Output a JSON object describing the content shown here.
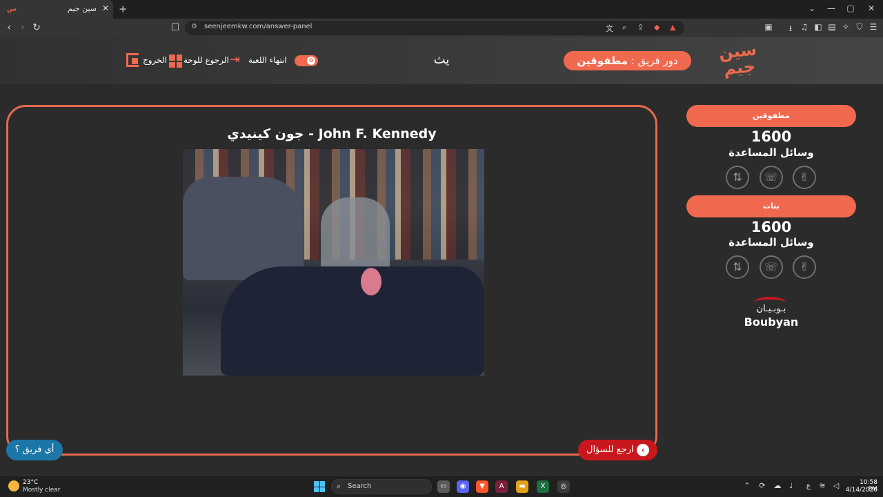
{
  "browser": {
    "tab_title": "سين جيم",
    "tab_close": "✕",
    "new_tab": "+",
    "url": "seenjeemkw.com/answer-panel",
    "window_controls": [
      "⌄",
      "—",
      "▢",
      "✕"
    ]
  },
  "header": {
    "logo_text": "سين جيم",
    "turn_prefix": "دور فريق :",
    "turn_team": "مطفوقين",
    "center_text": "يث",
    "end_game_label": "انتهاء اللعبة",
    "back_board_label": "الرجوع للوحة",
    "exit_label": "الخروج"
  },
  "answer": {
    "title": "جون كينيدي - John F. Kennedy",
    "image_icon": "photo-image"
  },
  "buttons": {
    "which_team": "أي فريق ؟",
    "back_to_question": "ارجع للسؤال",
    "back_to_question_icon": "‹"
  },
  "teams": [
    {
      "name": "مطفوقين",
      "score": "1600",
      "aids_label": "وسائل المساعدة",
      "aids": [
        "✌",
        "☏",
        "⇅"
      ]
    },
    {
      "name": "بنات",
      "score": "1600",
      "aids_label": "وسائل المساعدة",
      "aids": [
        "✌",
        "☏",
        "⇅"
      ]
    }
  ],
  "sponsor": {
    "arabic": "بـوبـيـان",
    "english": "Boubyan"
  },
  "taskbar": {
    "weather_temp": "23°C",
    "weather_desc": "Mostly clear",
    "search_label": "Search",
    "time": "10:58 PM",
    "date": "4/14/2026",
    "ime": "ع"
  },
  "colors": {
    "accent": "#f0694e",
    "danger": "#c8181d",
    "info": "#1c76a8",
    "background": "#2b2b2b"
  }
}
